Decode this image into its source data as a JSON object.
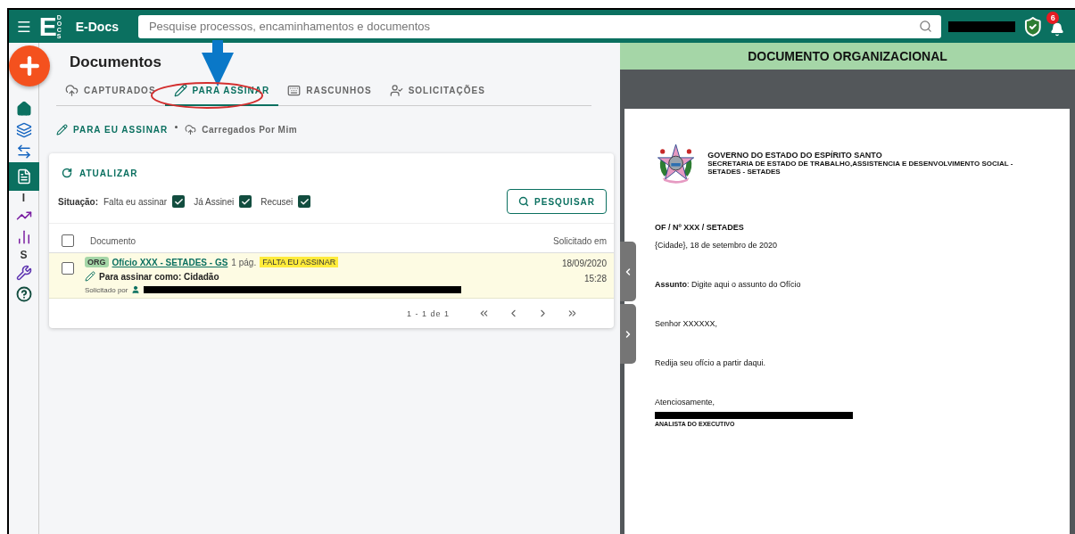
{
  "header": {
    "logo_letter": "E",
    "logo_sub": "DOCS",
    "app_name": "E-Docs",
    "search": {
      "placeholder": "Pesquise processos, encaminhamentos e documentos"
    },
    "notification_count": "6"
  },
  "sidebar": {
    "items": [
      {
        "kind": "home",
        "selected": false
      },
      {
        "kind": "cards",
        "selected": false
      },
      {
        "kind": "swap",
        "selected": false
      },
      {
        "kind": "document",
        "selected": true
      },
      {
        "kind": "letter",
        "label": "I",
        "selected": false
      },
      {
        "kind": "trend",
        "selected": false
      },
      {
        "kind": "bars",
        "selected": false
      },
      {
        "kind": "letter",
        "label": "S",
        "selected": false
      },
      {
        "kind": "wrench",
        "selected": false
      },
      {
        "kind": "help",
        "selected": false
      }
    ]
  },
  "page_title": "Documentos",
  "tabs": [
    {
      "kind": "upload",
      "label": "CAPTURADOS",
      "selected": false
    },
    {
      "kind": "pencil",
      "label": "PARA ASSINAR",
      "selected": true
    },
    {
      "kind": "keyboard",
      "label": "RASCUNHOS",
      "selected": false
    },
    {
      "kind": "person",
      "label": "SOLICITAÇÕES",
      "selected": false
    }
  ],
  "subtabs": [
    {
      "kind": "pencil",
      "label": "PARA EU ASSINAR",
      "selected": true
    },
    {
      "kind": "upload",
      "label": "Carregados Por Mim",
      "selected": false
    }
  ],
  "card": {
    "refresh": "ATUALIZAR",
    "filter_label": "Situação:",
    "filters": [
      {
        "label": "Falta eu assinar",
        "checked": true
      },
      {
        "label": "Já Assinei",
        "checked": true
      },
      {
        "label": "Recusei",
        "checked": true
      }
    ],
    "search_button": "PESQUISAR",
    "table": {
      "select_all": {
        "checked": false
      },
      "columns": [
        "Documento",
        "Solicitado em"
      ],
      "rows": [
        {
          "checked": false,
          "tag": "ORG",
          "title": "Ofício XXX - SETADES - GS",
          "pages": "1 pág.",
          "status": "FALTA EU ASSINAR",
          "sign_as": "Para assinar como: Cidadão",
          "requested_by": "Solicitado por",
          "date": "18/09/2020",
          "time": "15:28"
        }
      ]
    },
    "pagination": "1 - 1 de 1"
  },
  "document": {
    "title": "DOCUMENTO ORGANIZACIONAL",
    "org_lines": [
      "GOVERNO DO ESTADO DO ESPÍRITO SANTO",
      "SECRETARIA DE ESTADO DE TRABALHO,ASSISTENCIA E DESENVOLVIMENTO SOCIAL - SETADES - SETADES"
    ],
    "reference": "OF / Nº XXX / SETADES",
    "date_line": "{Cidade}, 18 de setembro de 2020",
    "subject": "**Assunto**: Digite aqui o assunto do Ofício",
    "greeting": "Senhor XXXXXX,",
    "body": "Redija seu ofício a partir daqui.",
    "closing": "Atenciosamente,",
    "signer_role": "ANALISTA DO EXECUTIVO"
  }
}
